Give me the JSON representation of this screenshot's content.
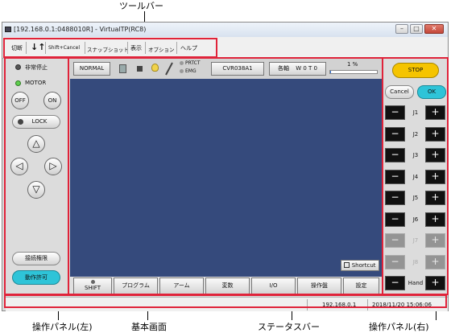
{
  "callouts": {
    "toolbar": "ツールバー",
    "left_panel": "操作パネル(左)",
    "main_screen": "基本画面",
    "status_bar": "ステータスバー",
    "right_panel": "操作パネル(右)"
  },
  "window": {
    "title": "[192.168.0.1:0488010R] - VirtualTP(RC8)",
    "minimize": "–",
    "maximize": "□",
    "close": "✕"
  },
  "menu": {
    "items": [
      "切断",
      "↓↑",
      "Shift+Cancel",
      "スナップショット",
      "表示",
      "オプション",
      "ヘルプ"
    ]
  },
  "left_panel": {
    "emergency_label": "非常停止",
    "motor_label": "MOTOR",
    "off_label": "OFF",
    "on_label": "ON",
    "lock_label": "LOCK",
    "arrows": [
      "△",
      "◁",
      "▷",
      "▽"
    ],
    "connection_label": "接続権限",
    "operation_label": "動作許可"
  },
  "top_bar": {
    "mode": "NORMAL",
    "protect": "PRTCT",
    "emg": "EMG",
    "robot": "CVR038A1",
    "axis": "各軸",
    "tool": "W 0 T 0",
    "speed": "1 %",
    "speed_value": 0.01
  },
  "main": {
    "shortcut_label": "Shortcut",
    "tabs": [
      "SHIFT",
      "プログラム",
      "アーム",
      "変数",
      "I/O",
      "操作盤",
      "設定"
    ]
  },
  "right_panel": {
    "stop_label": "STOP",
    "cancel_label": "Cancel",
    "ok_label": "OK",
    "joints": [
      {
        "label": "J1",
        "enabled": true
      },
      {
        "label": "J2",
        "enabled": true
      },
      {
        "label": "J3",
        "enabled": true
      },
      {
        "label": "J4",
        "enabled": true
      },
      {
        "label": "J5",
        "enabled": true
      },
      {
        "label": "J6",
        "enabled": true
      },
      {
        "label": "J7",
        "enabled": false
      },
      {
        "label": "J8",
        "enabled": false
      },
      {
        "label": "Hand",
        "enabled": true
      }
    ],
    "minus": "−",
    "plus": "+"
  },
  "status_bar": {
    "ip": "192.168.0.1",
    "datetime": "2018/11/20 15:06:06"
  },
  "colors": {
    "highlight": "#e0233a",
    "screen": "#354a7c",
    "stop": "#f5c400",
    "accent": "#2ec4d8",
    "motor_led": "#5fcf4e"
  },
  "icons": [
    "app-icon",
    "teach-pendant-icon",
    "square-icon",
    "lightbulb-icon",
    "tool-icon",
    "shortcut-icon"
  ]
}
